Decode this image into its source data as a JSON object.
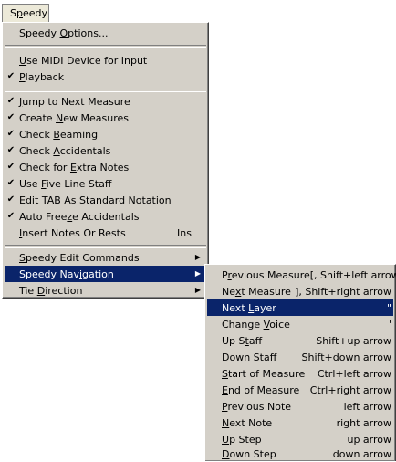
{
  "menu_title": {
    "pre": "S",
    "u": "p",
    "post": "eedy"
  },
  "main_menu": {
    "items": [
      {
        "pre": "Speedy ",
        "u": "O",
        "post": "ptions...",
        "checked": false
      },
      {
        "pre": "",
        "u": "U",
        "post": "se MIDI Device for Input",
        "checked": false
      },
      {
        "pre": "",
        "u": "P",
        "post": "layback",
        "checked": true
      },
      {
        "pre": "",
        "u": "J",
        "post": "ump to Next Measure",
        "checked": true
      },
      {
        "pre": "Create ",
        "u": "N",
        "post": "ew Measures",
        "checked": true
      },
      {
        "pre": "Check ",
        "u": "B",
        "post": "eaming",
        "checked": true
      },
      {
        "pre": "Check ",
        "u": "A",
        "post": "ccidentals",
        "checked": true
      },
      {
        "pre": "Check for ",
        "u": "E",
        "post": "xtra Notes",
        "checked": true
      },
      {
        "pre": "Use ",
        "u": "F",
        "post": "ive Line Staff",
        "checked": true
      },
      {
        "pre": "Edit ",
        "u": "T",
        "post": "AB As Standard Notation",
        "checked": true
      },
      {
        "pre": "Auto Free",
        "u": "z",
        "post": "e Accidentals",
        "checked": true
      },
      {
        "pre": "",
        "u": "I",
        "post": "nsert Notes Or Rests",
        "checked": false,
        "shortcut": "Ins"
      },
      {
        "pre": "",
        "u": "S",
        "post": "peedy Edit Commands",
        "checked": false,
        "submenu": true
      },
      {
        "pre": "Speedy Nav",
        "u": "i",
        "post": "gation",
        "checked": false,
        "submenu": true,
        "selected": true
      },
      {
        "pre": "Tie ",
        "u": "D",
        "post": "irection",
        "checked": false,
        "submenu": true
      }
    ]
  },
  "submenu": {
    "items": [
      {
        "pre": "P",
        "u": "r",
        "post": "evious Measure",
        "shortcut": "[, Shift+left arrow"
      },
      {
        "pre": "Ne",
        "u": "x",
        "post": "t Measure",
        "shortcut": "], Shift+right arrow"
      },
      {
        "pre": "Next ",
        "u": "L",
        "post": "ayer",
        "shortcut": "\"",
        "selected": true
      },
      {
        "pre": "Change ",
        "u": "V",
        "post": "oice",
        "shortcut": "'"
      },
      {
        "pre": "Up S",
        "u": "t",
        "post": "aff",
        "shortcut": "Shift+up arrow"
      },
      {
        "pre": "Down St",
        "u": "a",
        "post": "ff",
        "shortcut": "Shift+down arrow"
      },
      {
        "pre": "",
        "u": "S",
        "post": "tart of Measure",
        "shortcut": "Ctrl+left arrow"
      },
      {
        "pre": "",
        "u": "E",
        "post": "nd of Measure",
        "shortcut": "Ctrl+right arrow"
      },
      {
        "pre": "",
        "u": "P",
        "post": "revious Note",
        "shortcut": "left arrow"
      },
      {
        "pre": "",
        "u": "N",
        "post": "ext Note",
        "shortcut": "right arrow"
      },
      {
        "pre": "",
        "u": "U",
        "post": "p Step",
        "shortcut": "up arrow"
      },
      {
        "pre": "",
        "u": "D",
        "post": "own Step",
        "shortcut": "down arrow"
      }
    ]
  },
  "icons": {
    "check": "check-icon",
    "submenu_arrow": "chevron-right-icon"
  },
  "colors": {
    "menu_bg": "#d4d0c8",
    "highlight": "#0a246a",
    "highlight_text": "#ffffff"
  }
}
